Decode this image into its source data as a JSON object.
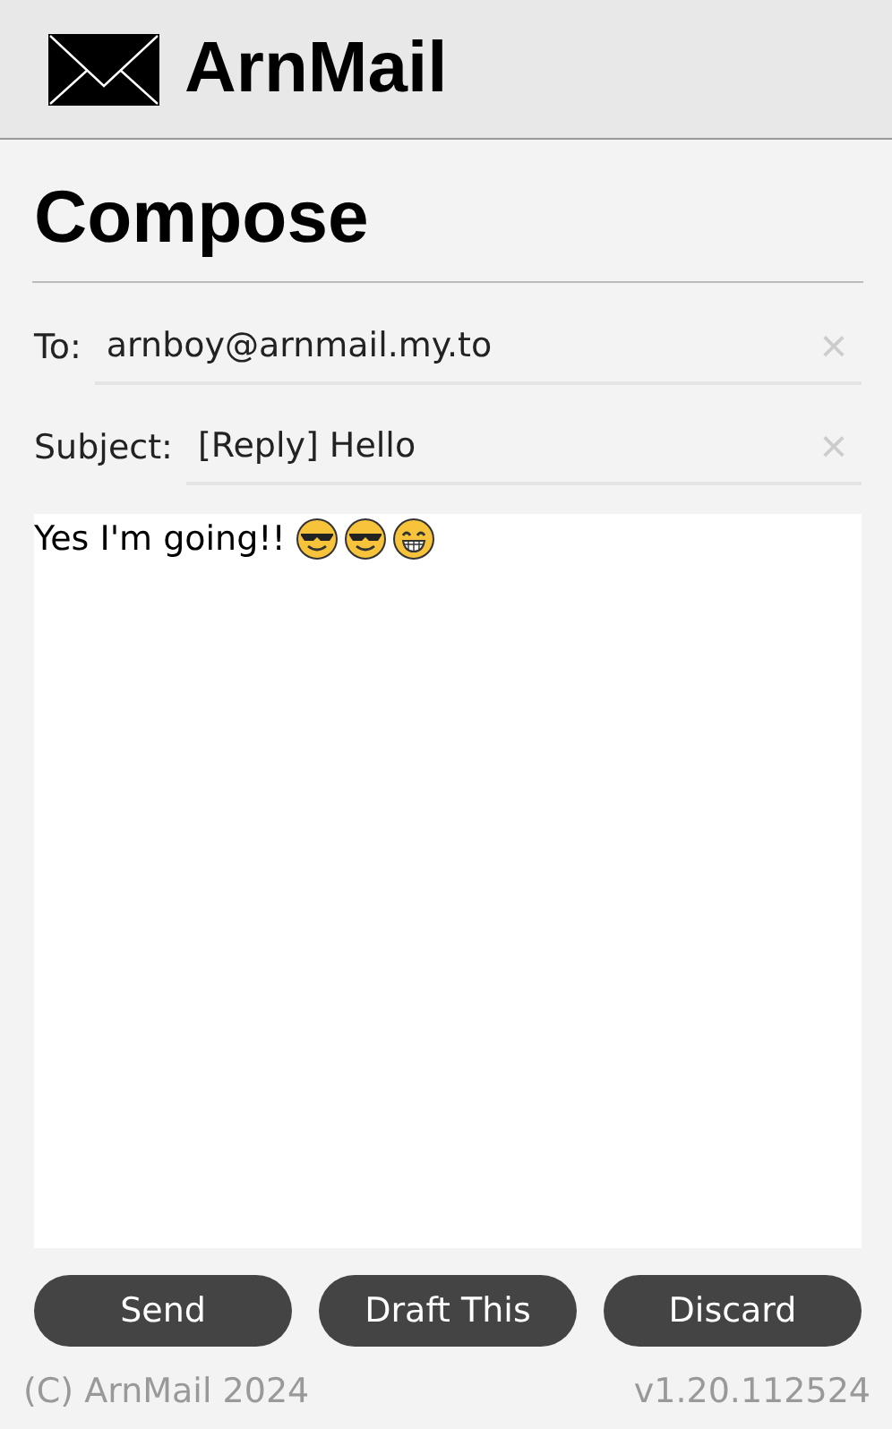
{
  "app": {
    "name": "ArnMail"
  },
  "heading": "Compose",
  "fields": [
    {
      "label": "To:",
      "value": "arnboy@arnmail.my.to",
      "clear": "×"
    },
    {
      "label": "Subject:",
      "value": "[Reply] Hello",
      "clear": "×"
    }
  ],
  "body": {
    "text": "Yes I'm going!!",
    "emojis": [
      {
        "kind": "sunglasses"
      },
      {
        "kind": "sunglasses"
      },
      {
        "kind": "grin"
      }
    ]
  },
  "buttons": [
    "Send",
    "Draft This",
    "Discard"
  ],
  "footer": {
    "copyright": "(C) ArnMail 2024",
    "version": "v1.20.112524"
  }
}
